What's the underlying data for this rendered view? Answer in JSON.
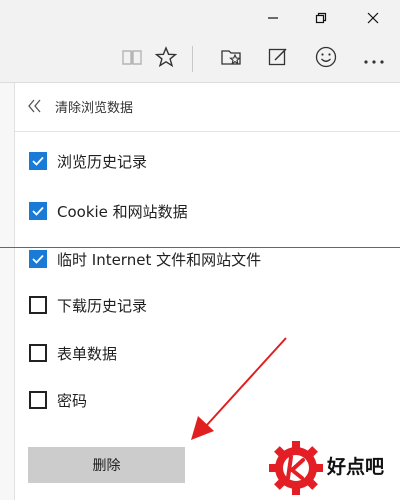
{
  "window": {
    "minimize_icon": "minimize-icon",
    "restore_icon": "restore-icon",
    "close_icon": "close-icon"
  },
  "toolbar": {
    "icons": [
      "reading-view-icon",
      "favorite-star-icon",
      "hub-icon",
      "web-note-icon",
      "feedback-smiley-icon",
      "more-icon"
    ]
  },
  "panel": {
    "title": "清除浏览数据",
    "options": [
      {
        "label": "浏览历史记录",
        "checked": true
      },
      {
        "label": "Cookie 和网站数据",
        "checked": true
      },
      {
        "label": "临时 Internet 文件和网站文件",
        "checked": true
      },
      {
        "label": "下载历史记录",
        "checked": false
      },
      {
        "label": "表单数据",
        "checked": false
      },
      {
        "label": "密码",
        "checked": false
      }
    ],
    "delete_label": "删除"
  },
  "watermark": {
    "text": "好点吧"
  },
  "colors": {
    "accent": "#1a7bd6",
    "annotation_red": "#e02020",
    "button_gray": "#cccccc"
  }
}
